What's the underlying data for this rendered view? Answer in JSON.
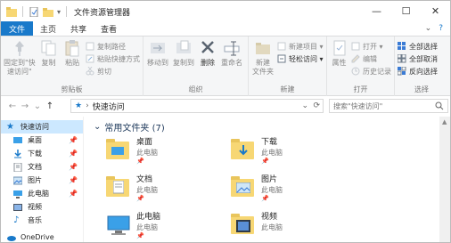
{
  "window": {
    "title": "文件资源管理器"
  },
  "window_controls": {
    "minimize": "—",
    "maximize": "☐",
    "close": "✕"
  },
  "tabs": [
    {
      "label": "文件"
    },
    {
      "label": "主页"
    },
    {
      "label": "共享"
    },
    {
      "label": "查看"
    }
  ],
  "tabs_right": {
    "collapse": "⌄",
    "help": "?"
  },
  "ribbon": {
    "clipboard": {
      "label": "剪贴板",
      "pin": "固定到\"快\n速访问\"",
      "copy": "复制",
      "paste": "粘贴",
      "copy_path": "复制路径",
      "paste_shortcut": "粘贴快捷方式",
      "cut": "剪切"
    },
    "organize": {
      "label": "组织",
      "move_to": "移动到",
      "copy_to": "复制到",
      "delete": "删除",
      "rename": "重命名"
    },
    "new": {
      "label": "新建",
      "new_folder": "新建\n文件夹",
      "new_item": "新建项目 ▾",
      "easy_access": "轻松访问 ▾"
    },
    "open": {
      "label": "打开",
      "properties": "属性",
      "open": "打开 ▾",
      "edit": "编辑",
      "history": "历史记录"
    },
    "select": {
      "label": "选择",
      "select_all": "全部选择",
      "select_none": "全部取消",
      "invert": "反向选择"
    }
  },
  "address": {
    "back": "←",
    "forward": "→",
    "recent": "⌄",
    "up": "↑",
    "path": "快速访问",
    "refresh": "⟳",
    "search_placeholder": "搜索\"快速访问\""
  },
  "nav": {
    "quick_access": "快速访问",
    "items": [
      {
        "label": "桌面",
        "pinned": true
      },
      {
        "label": "下载",
        "pinned": true
      },
      {
        "label": "文档",
        "pinned": true
      },
      {
        "label": "图片",
        "pinned": true
      },
      {
        "label": "此电脑",
        "pinned": true
      },
      {
        "label": "视频",
        "pinned": false
      },
      {
        "label": "音乐",
        "pinned": false
      }
    ],
    "onedrive": "OneDrive"
  },
  "content": {
    "group_title": "常用文件夹 (7)",
    "tiles": [
      {
        "name": "桌面",
        "sub": "此电脑"
      },
      {
        "name": "下载",
        "sub": "此电脑"
      },
      {
        "name": "文档",
        "sub": "此电脑"
      },
      {
        "name": "图片",
        "sub": "此电脑"
      },
      {
        "name": "此电脑",
        "sub": "此电脑"
      },
      {
        "name": "视频",
        "sub": "此电脑"
      }
    ]
  },
  "colors": {
    "accent": "#1979ca",
    "selection": "#cce8ff",
    "folder": "#f7d774"
  }
}
